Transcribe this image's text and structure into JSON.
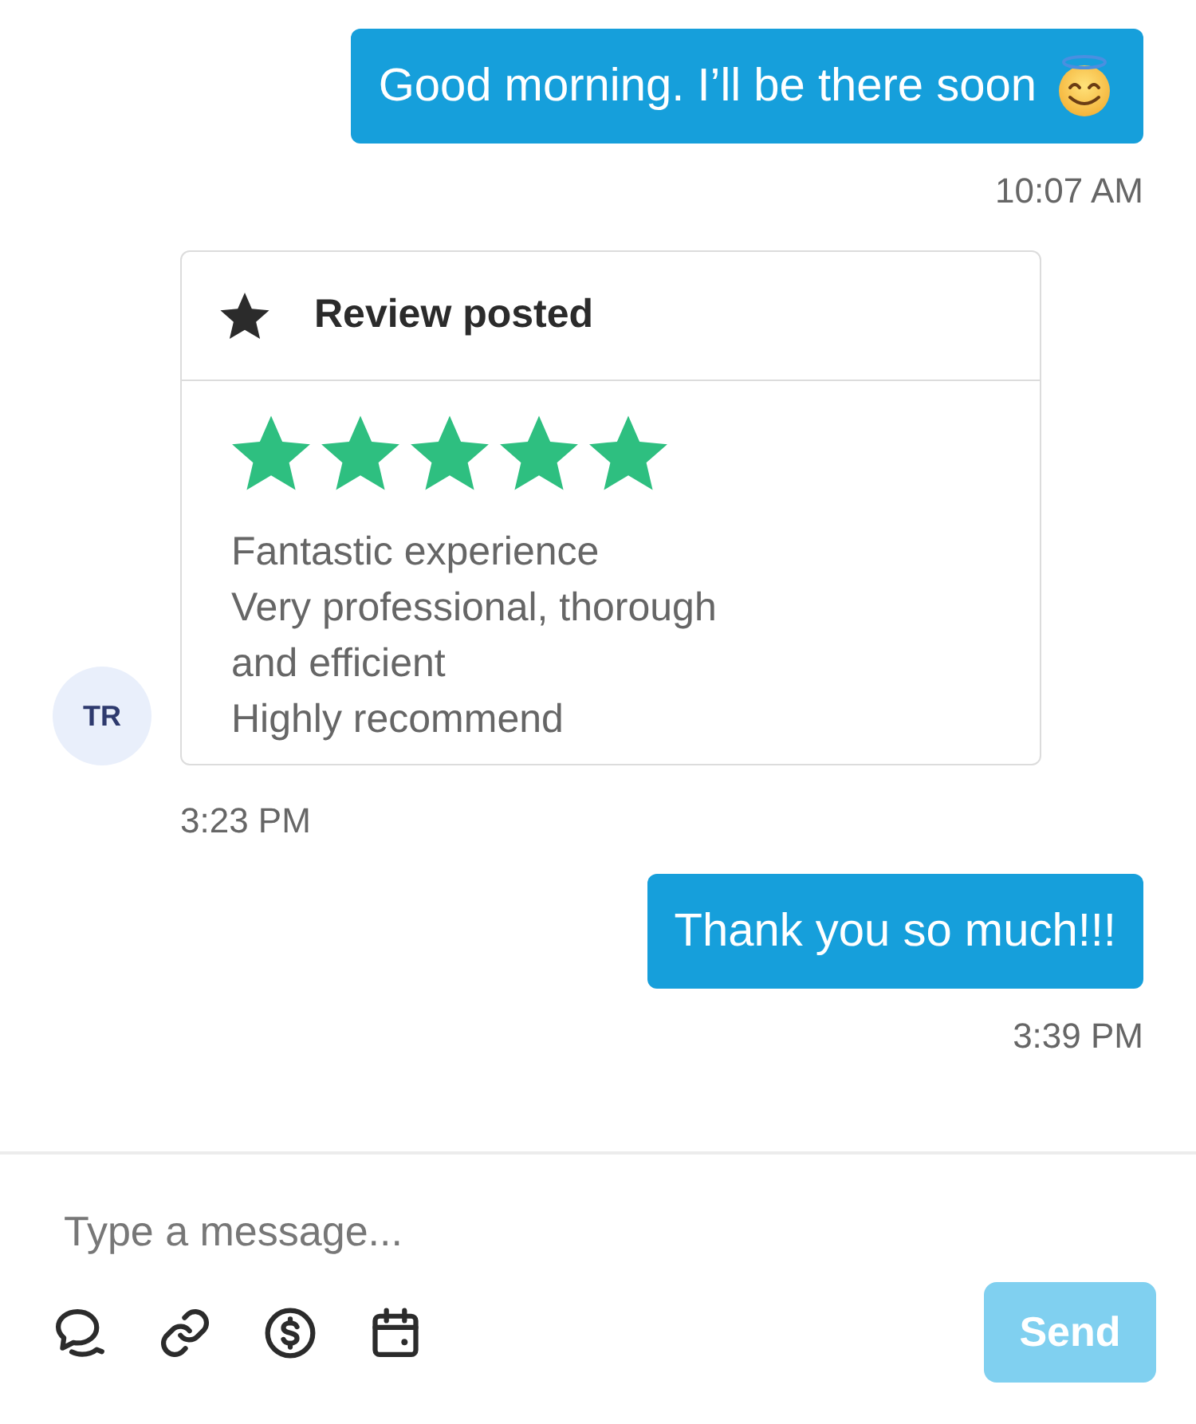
{
  "conversation": [
    {
      "kind": "outgoing",
      "text": "Good morning. I’ll be there soon",
      "emoji": true,
      "time": "10:07 AM"
    },
    {
      "kind": "review",
      "sender": {
        "initials": "TR"
      },
      "title": "Review posted",
      "stars": 5,
      "lines": [
        "Fantastic experience",
        "Very professional, thorough",
        "and efficient",
        "Highly recommend"
      ],
      "time": "3:23 PM"
    },
    {
      "kind": "outgoing",
      "text": "Thank you so much!!!",
      "time": "3:39 PM"
    }
  ],
  "composer": {
    "placeholder": "Type a message...",
    "send": {
      "label": "Send",
      "disabled": true
    }
  }
}
